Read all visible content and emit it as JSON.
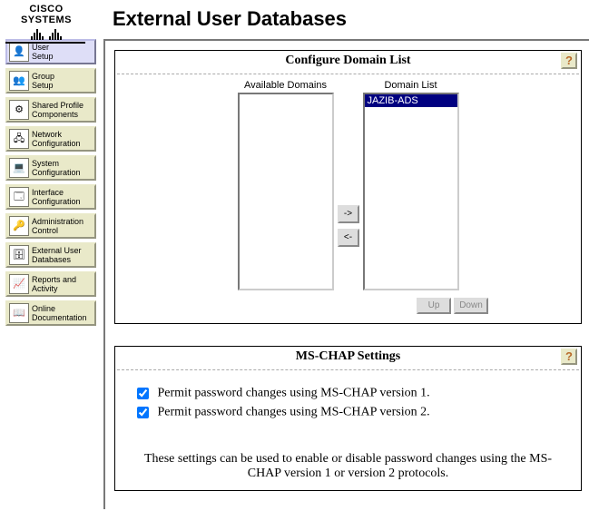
{
  "logo": {
    "text": "CISCO SYSTEMS"
  },
  "page_title": "External User Databases",
  "sidebar": {
    "items": [
      {
        "label": "User\nSetup",
        "icon": "👤"
      },
      {
        "label": "Group\nSetup",
        "icon": "👥"
      },
      {
        "label": "Shared Profile\nComponents",
        "icon": "⚙"
      },
      {
        "label": "Network\nConfiguration",
        "icon": "🖧"
      },
      {
        "label": "System\nConfiguration",
        "icon": "💻"
      },
      {
        "label": "Interface\nConfiguration",
        "icon": "🗔"
      },
      {
        "label": "Administration\nControl",
        "icon": "🔑"
      },
      {
        "label": "External User\nDatabases",
        "icon": "🗄"
      },
      {
        "label": "Reports and\nActivity",
        "icon": "📈"
      },
      {
        "label": "Online\nDocumentation",
        "icon": "📖"
      }
    ]
  },
  "domain_panel": {
    "title": "Configure Domain List",
    "available_label": "Available Domains",
    "list_label": "Domain List",
    "available_items": [],
    "list_items": [
      "JAZIB-ADS"
    ],
    "add_label": "->",
    "remove_label": "<-",
    "up_label": "Up",
    "down_label": "Down",
    "help": "?"
  },
  "mschap_panel": {
    "title": "MS-CHAP Settings",
    "help": "?",
    "check1_label": "Permit password changes using MS-CHAP version 1.",
    "check2_label": "Permit password changes using MS-CHAP version 2.",
    "check1_checked": true,
    "check2_checked": true,
    "description": "These settings can be used to enable or disable password changes using the MS-CHAP version 1 or version 2 protocols."
  }
}
